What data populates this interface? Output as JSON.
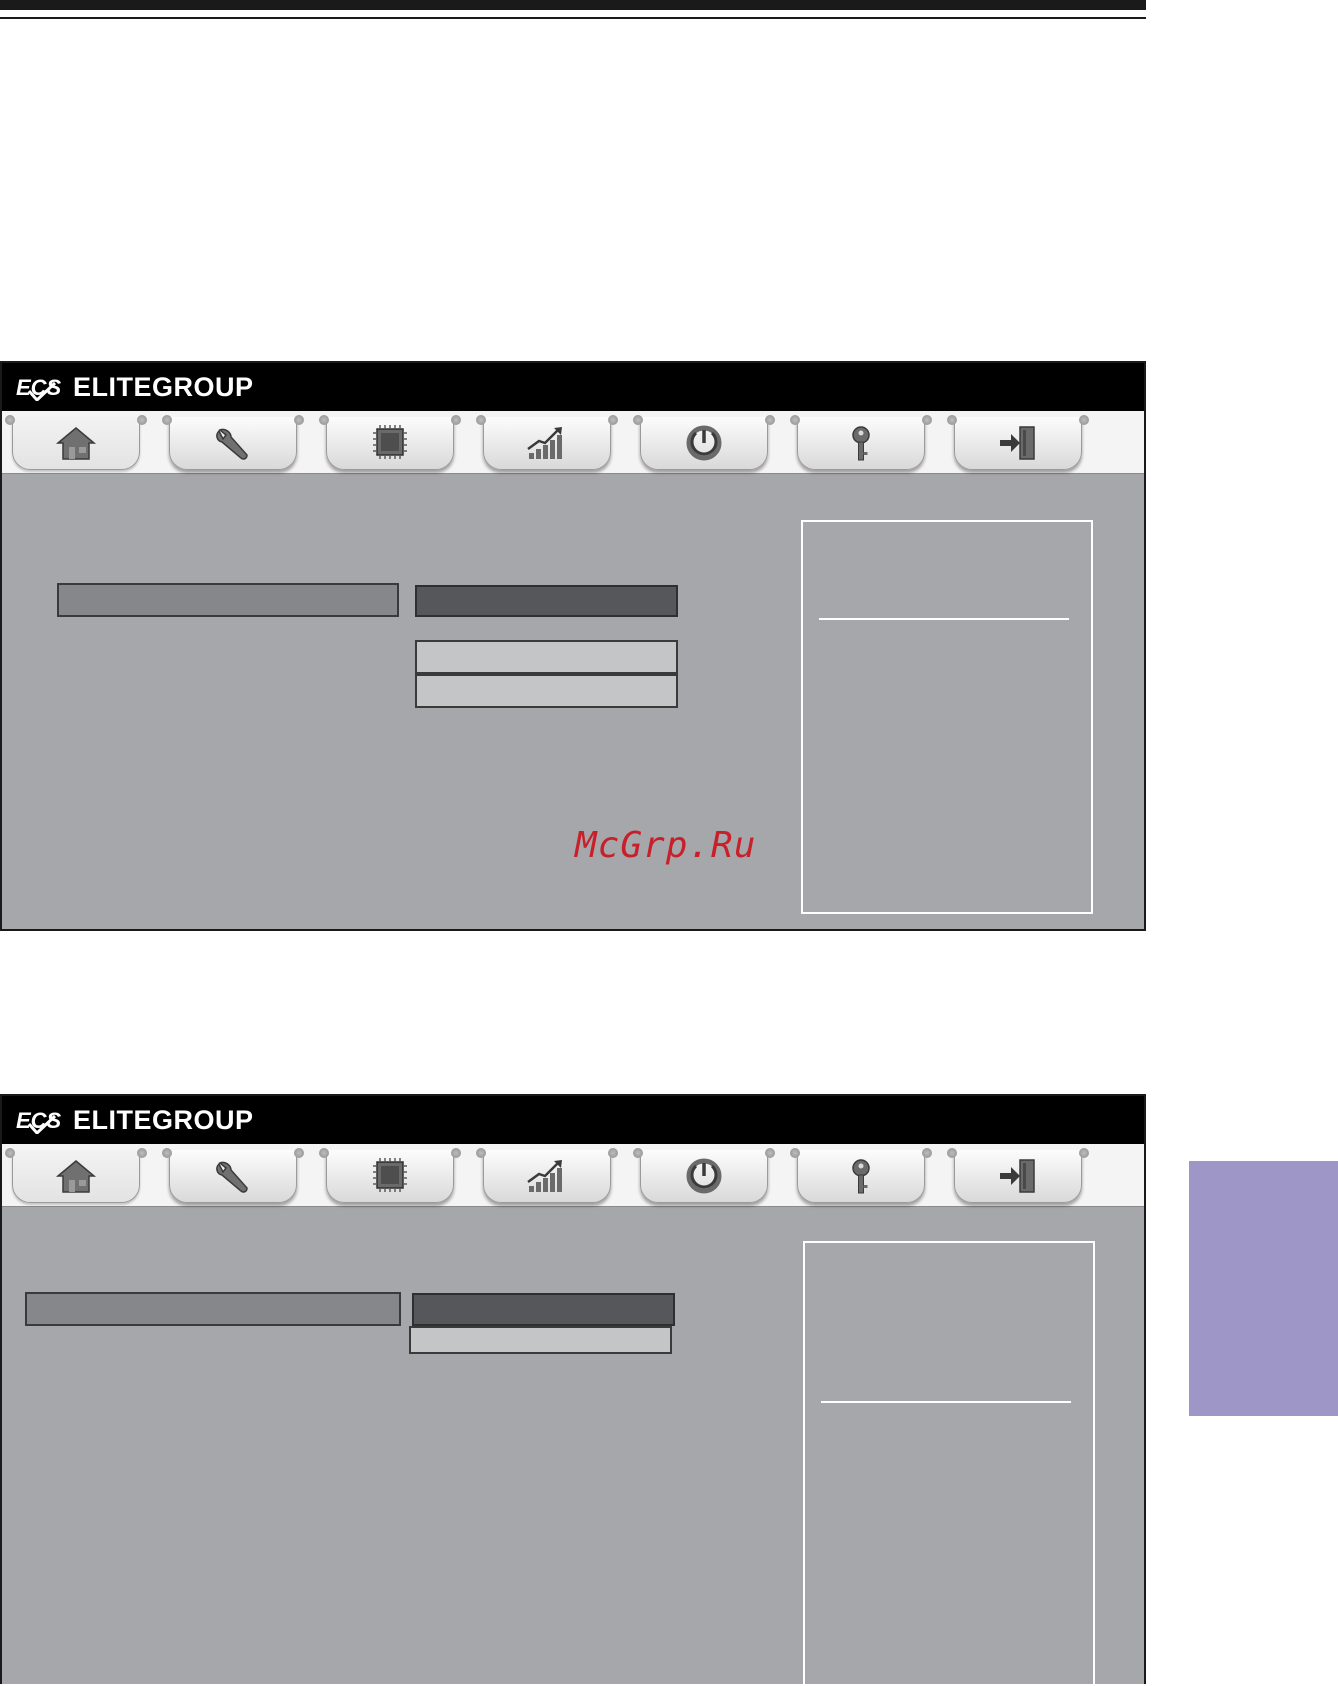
{
  "bios_screens": [
    {
      "brand": "ELITEGROUP",
      "logo_text": "ECS",
      "tabs": [
        {
          "name": "main",
          "icon": "home-icon",
          "active": true
        },
        {
          "name": "advanced",
          "icon": "wrench-icon",
          "active": false
        },
        {
          "name": "chipset",
          "icon": "chip-icon",
          "active": false
        },
        {
          "name": "m-i-b",
          "icon": "performance-chart-icon",
          "active": false
        },
        {
          "name": "boot",
          "icon": "power-icon",
          "active": false
        },
        {
          "name": "security",
          "icon": "key-icon",
          "active": false
        },
        {
          "name": "exit",
          "icon": "exit-door-icon",
          "active": false
        }
      ]
    },
    {
      "brand": "ELITEGROUP",
      "logo_text": "ECS",
      "tabs": [
        {
          "name": "main",
          "icon": "home-icon",
          "active": true
        },
        {
          "name": "advanced",
          "icon": "wrench-icon",
          "active": false
        },
        {
          "name": "chipset",
          "icon": "chip-icon",
          "active": false
        },
        {
          "name": "m-i-b",
          "icon": "performance-chart-icon",
          "active": false
        },
        {
          "name": "boot",
          "icon": "power-icon",
          "active": false
        },
        {
          "name": "security",
          "icon": "key-icon",
          "active": false
        },
        {
          "name": "exit",
          "icon": "exit-door-icon",
          "active": false
        }
      ]
    }
  ],
  "watermark": "McGrp.Ru",
  "colors": {
    "panel_bg": "#a6a7ab",
    "header_bg": "#000000",
    "side_tab": "#9f96c8",
    "watermark": "#c8202a"
  }
}
